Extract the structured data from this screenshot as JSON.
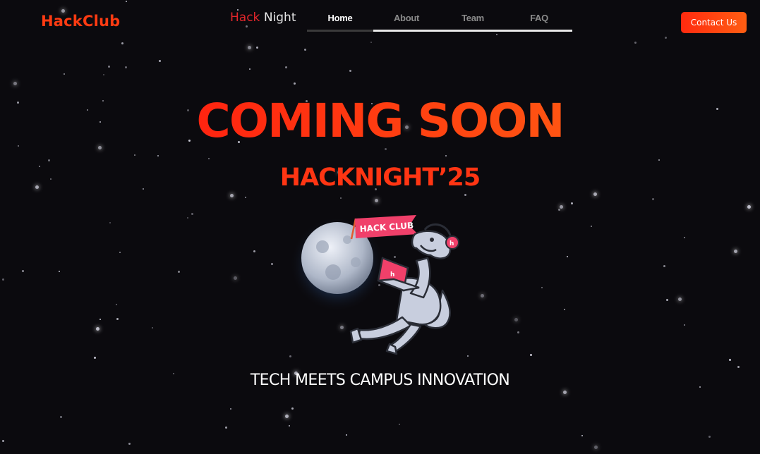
{
  "header": {
    "brand": "HackClub",
    "event_logo": {
      "part1": "Hack",
      "part2": "Night"
    },
    "nav": [
      {
        "label": "Home",
        "active": true
      },
      {
        "label": "About",
        "active": false
      },
      {
        "label": "Team",
        "active": false
      },
      {
        "label": "FAQ",
        "active": false
      }
    ],
    "contact_label": "Contact Us"
  },
  "hero": {
    "headline": "COMING SOON",
    "subheadline": "HACKNIGHT’25",
    "illustration": {
      "name": "hack-club-dino-moon-illustration",
      "flag_text": "HACK CLUB",
      "laptop_letter": "h",
      "headphone_letter": "h"
    },
    "tagline": "TECH MEETS CAMPUS INNOVATION"
  },
  "colors": {
    "background": "#0b0a0e",
    "accent": "#ff3513",
    "accent_gradient_end": "#ff5e12"
  }
}
